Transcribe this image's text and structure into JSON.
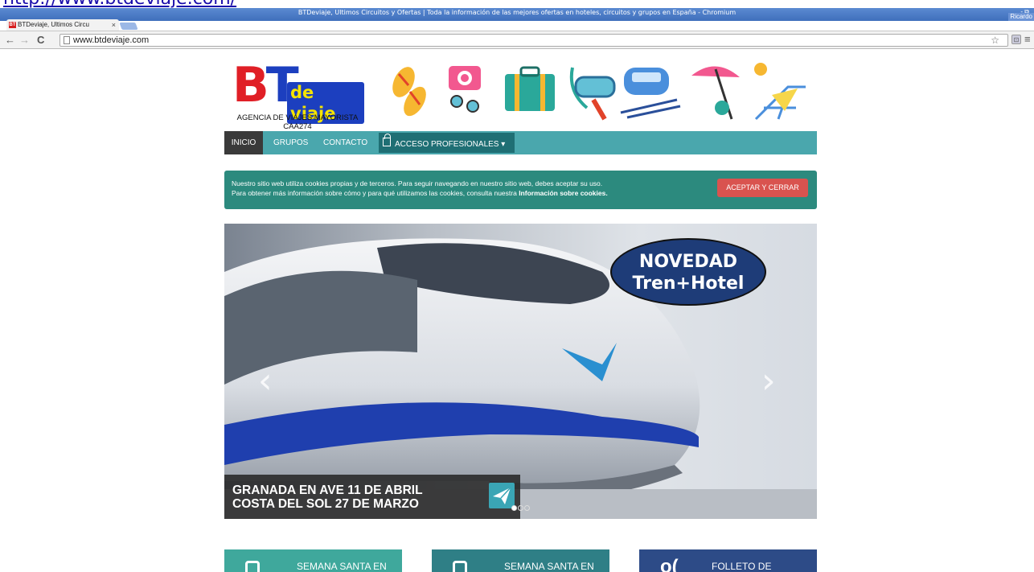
{
  "page_url_caption": "http://www.btdeviaje.com/",
  "window": {
    "title": "BTDeviaje, Ultimos Circuitos y Ofertas | Toda la información de las mejores ofertas en hoteles, circuitos y grupos en España - Chromium",
    "user": "Ricardo",
    "controls": "- ⧉"
  },
  "tab": {
    "label": "BTDeviaje, Ultimos Circu",
    "favicon": "BT",
    "close": "×"
  },
  "toolbar": {
    "back": "←",
    "forward": "→",
    "reload": "C",
    "url": "www.btdeviaje.com",
    "star": "☆",
    "rss": "⊡",
    "menu": "≡"
  },
  "logo": {
    "letters_b": "B",
    "letters_t": "T",
    "de_viaje": "de viaje",
    "agency_line1": "AGENCIA DE VIAJES MAYORISTA",
    "agency_line2": "CAA274"
  },
  "nav": {
    "items": [
      {
        "label": "INICIO",
        "active": true
      },
      {
        "label": "GRUPOS",
        "active": false
      },
      {
        "label": "CONTACTO",
        "active": false
      }
    ],
    "pro_label": "ACCESO PROFESIONALES ▾"
  },
  "cookie": {
    "line1": "Nuestro sitio web utiliza cookies propias y de terceros. Para seguir navegando en nuestro sitio web, debes aceptar su uso.",
    "line2_prefix": "Para obtener más información sobre cómo y para qué utilizamos las cookies, consulta nuestra ",
    "line2_link": "Información sobre cookies.",
    "button": "ACEPTAR Y CERRAR"
  },
  "slider": {
    "badge_line1": "NOVEDAD",
    "badge_line2": "Tren+Hotel",
    "prev": "‹",
    "next": "›",
    "caption_line1": "GRANADA EN AVE 11 DE ABRIL",
    "caption_line2": "COSTA DEL SOL 27 DE MARZO",
    "slide_count": 3,
    "active_slide": 1
  },
  "cards": [
    {
      "label": "SEMANA SANTA EN",
      "color": "#3fa89c"
    },
    {
      "label": "SEMANA SANTA EN",
      "color": "#2f7f86"
    },
    {
      "label": "FOLLETO DE",
      "color": "#2d4b87"
    }
  ]
}
